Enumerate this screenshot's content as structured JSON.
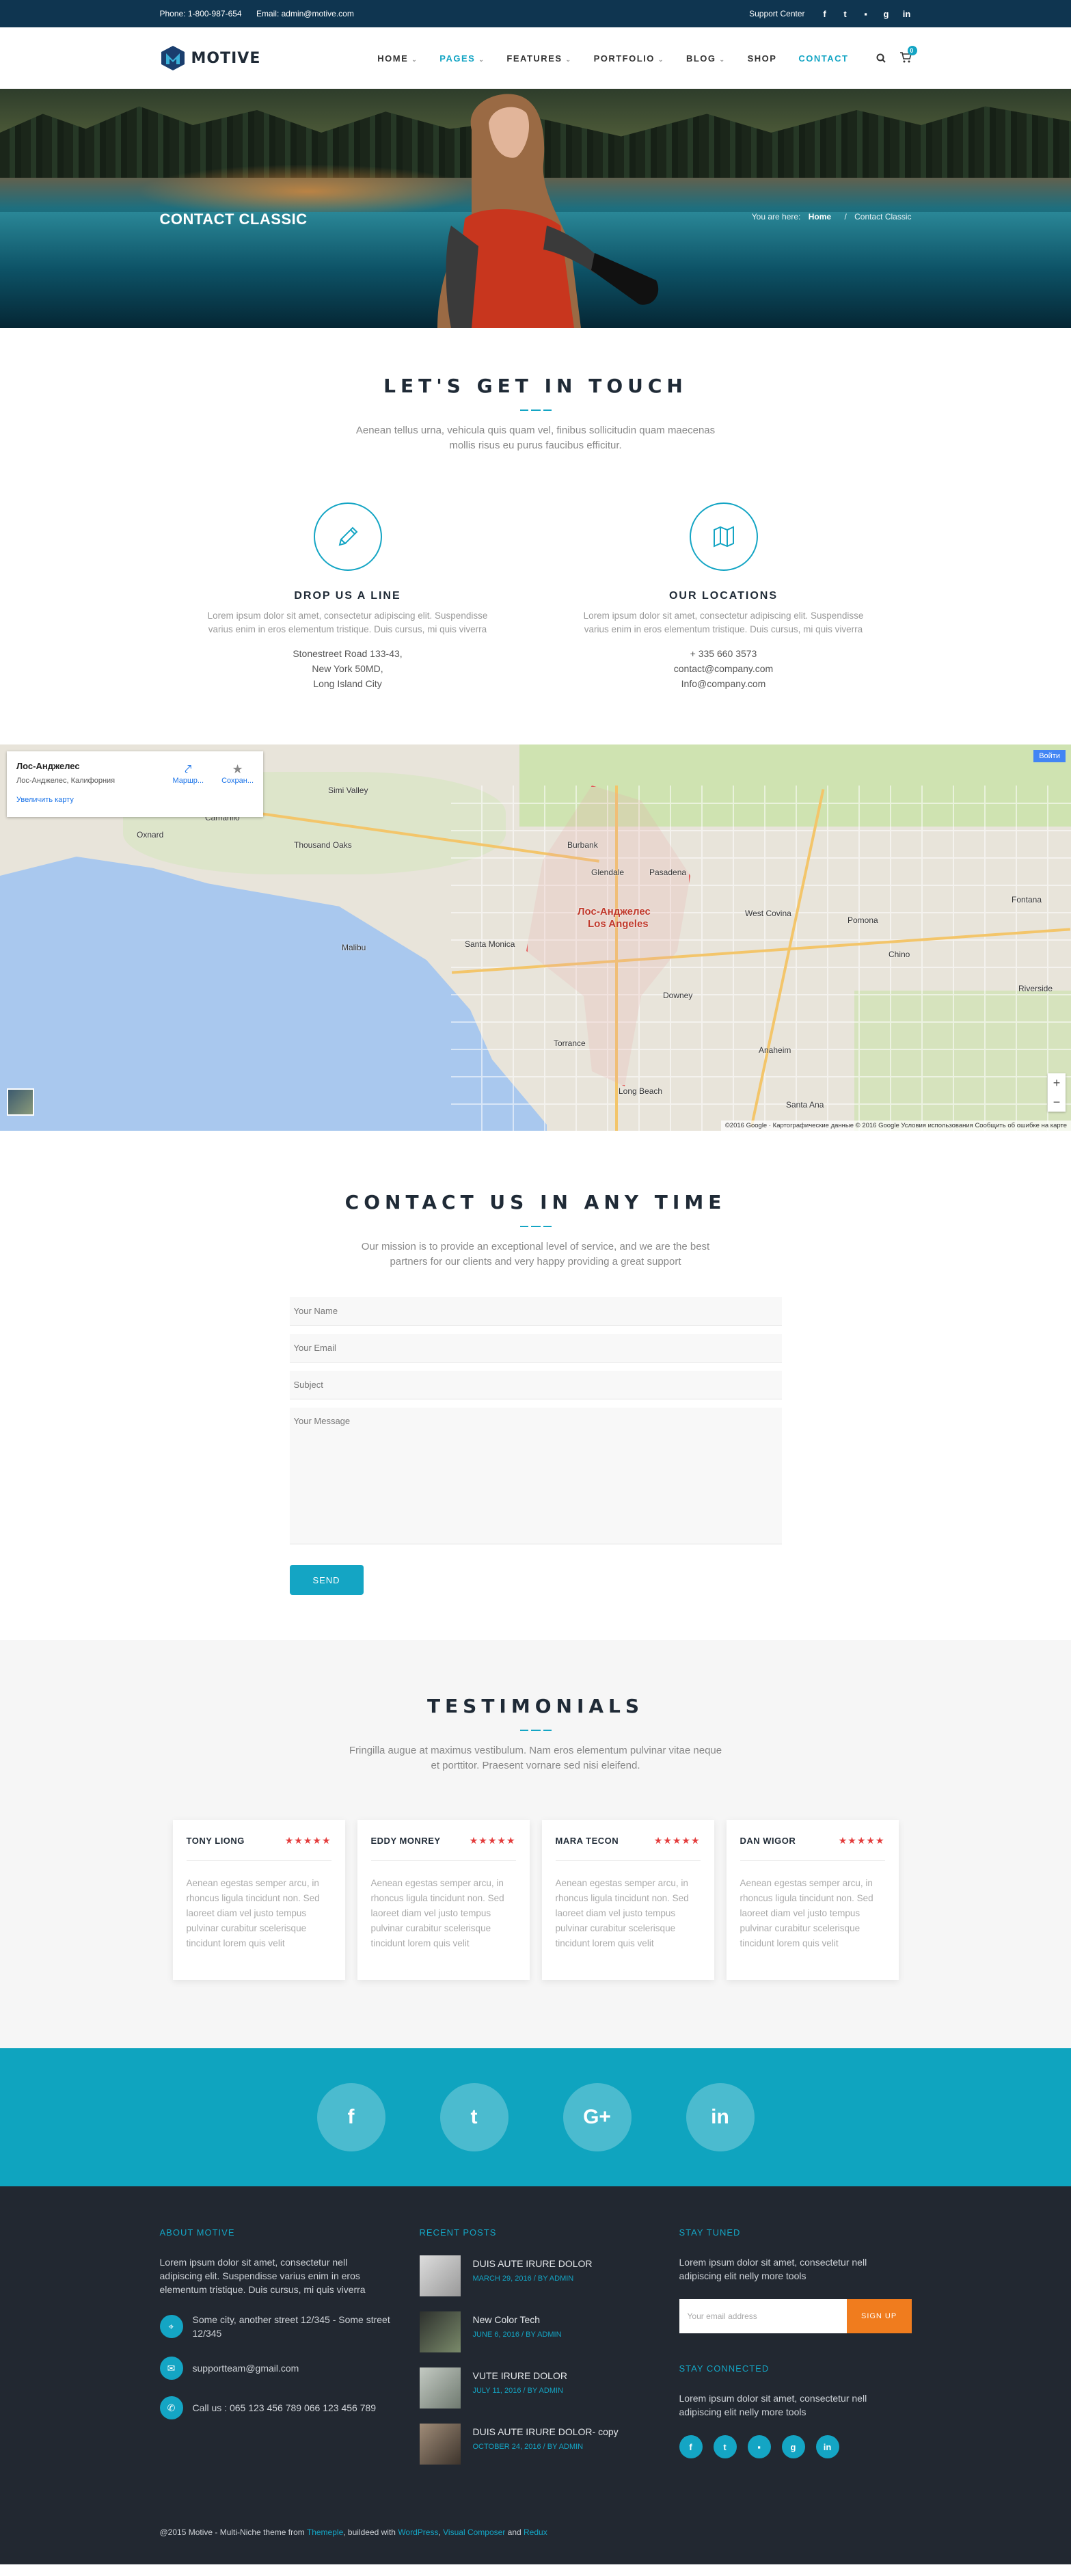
{
  "topbar": {
    "phone": "Phone: 1-800-987-654",
    "email": "Email: admin@motive.com",
    "support": "Support Center",
    "social": [
      {
        "icon": "facebook-icon",
        "glyph": "f"
      },
      {
        "icon": "twitter-icon",
        "glyph": "t"
      },
      {
        "icon": "flickr-icon",
        "glyph": "▪"
      },
      {
        "icon": "google-plus-icon",
        "glyph": "g"
      },
      {
        "icon": "linkedin-icon",
        "glyph": "in"
      }
    ]
  },
  "header": {
    "logo": "MOTIVE",
    "nav": [
      {
        "label": "HOME",
        "caret": true,
        "active": false
      },
      {
        "label": "PAGES",
        "caret": true,
        "active": true
      },
      {
        "label": "FEATURES",
        "caret": true,
        "active": false
      },
      {
        "label": "PORTFOLIO",
        "caret": true,
        "active": false
      },
      {
        "label": "BLOG",
        "caret": true,
        "active": false
      },
      {
        "label": "SHOP",
        "caret": false,
        "active": false
      },
      {
        "label": "CONTACT",
        "caret": false,
        "active": true
      }
    ],
    "cart_count": "0"
  },
  "hero": {
    "title": "CONTACT CLASSIC",
    "crumb_prefix": "You are here:",
    "crumb_home": "Home",
    "crumb_sep": "/",
    "crumb_current": "Contact Classic"
  },
  "touch": {
    "title": "LET'S GET IN TOUCH",
    "subtitle": "Aenean tellus urna, vehicula quis quam vel, finibus sollicitudin quam maecenas mollis risus eu purus faucibus efficitur.",
    "cols": [
      {
        "icon": "pencil-icon",
        "title": "DROP US A LINE",
        "text": "Lorem ipsum dolor sit amet, consectetur adipiscing elit. Suspendisse varius enim in eros elementum tristique. Duis cursus, mi quis viverra",
        "lines": [
          "Stonestreet Road 133-43,",
          "New York 50MD,",
          "Long Island City"
        ]
      },
      {
        "icon": "map-icon",
        "title": "OUR LOCATIONS",
        "text": "Lorem ipsum dolor sit amet, consectetur adipiscing elit. Suspendisse varius enim in eros elementum tristique. Duis cursus, mi quis viverra",
        "lines": [
          "+ 335 660 3573",
          "contact@company.com",
          "Info@company.com"
        ]
      }
    ]
  },
  "map": {
    "place": "Лос-Анджелес",
    "place_sub": "Лос-Анджелес, Калифорния",
    "enlarge": "Увеличить карту",
    "route": "Маршр...",
    "save": "Сохран...",
    "login": "Войти",
    "footer": "©2016 Google · Картографические данные © 2016 Google   Условия использования   Сообщить об ошибке на карте",
    "labels": [
      "Simi Valley",
      "Thousand Oaks",
      "Oxnard",
      "Camarillo",
      "Burbank",
      "Glendale",
      "Pasadena",
      "Santa Monica",
      "Los Angeles",
      "West Covina",
      "Pomona",
      "Torrance",
      "Long Beach",
      "Anaheim",
      "Santa Ana",
      "Riverside",
      "Fontana",
      "Malibu",
      "Downey",
      "Chino"
    ],
    "city_big": "Лос-Анджелес",
    "city_big_en": "Los Angeles"
  },
  "contact": {
    "title": "CONTACT US IN ANY TIME",
    "subtitle": "Our mission is to provide an exceptional level of service, and we are the best partners for our clients and very happy providing a great support",
    "name_ph": "Your Name",
    "email_ph": "Your Email",
    "subject_ph": "Subject",
    "message_ph": "Your Message",
    "send": "SEND"
  },
  "testimonials": {
    "title": "TESTIMONIALS",
    "subtitle": "Fringilla augue at maximus vestibulum. Nam eros elementum pulvinar vitae neque et porttitor. Praesent vornare sed nisi eleifend.",
    "stars": "★★★★★",
    "rating": 5,
    "items": [
      {
        "name": "TONY LIONG",
        "text": "Aenean egestas semper arcu, in rhoncus ligula tincidunt non. Sed laoreet diam vel justo tempus pulvinar curabitur scelerisque tincidunt lorem quis velit"
      },
      {
        "name": "EDDY MONREY",
        "text": "Aenean egestas semper arcu, in rhoncus ligula tincidunt non. Sed laoreet diam vel justo tempus pulvinar curabitur scelerisque tincidunt lorem quis velit"
      },
      {
        "name": "MARA TECON",
        "text": "Aenean egestas semper arcu, in rhoncus ligula tincidunt non. Sed laoreet diam vel justo tempus pulvinar curabitur scelerisque tincidunt lorem quis velit"
      },
      {
        "name": "DAN WIGOR",
        "text": "Aenean egestas semper arcu, in rhoncus ligula tincidunt non. Sed laoreet diam vel justo tempus pulvinar curabitur scelerisque tincidunt lorem quis velit"
      }
    ]
  },
  "social_band": [
    {
      "icon": "facebook-icon",
      "glyph": "f"
    },
    {
      "icon": "twitter-icon",
      "glyph": "t"
    },
    {
      "icon": "google-plus-icon",
      "glyph": "G+"
    },
    {
      "icon": "linkedin-icon",
      "glyph": "in"
    }
  ],
  "footer": {
    "about_title": "ABOUT MOTIVE",
    "about_text": "Lorem ipsum dolor sit amet, consectetur nell adipiscing elit. Suspendisse varius enim in eros elementum tristique. Duis cursus, mi quis viverra",
    "contacts": [
      {
        "icon": "location-icon",
        "glyph": "⌖",
        "text": "Some city, another street 12/345 - Some street 12/345"
      },
      {
        "icon": "email-icon",
        "glyph": "✉",
        "text": "supportteam@gmail.com"
      },
      {
        "icon": "phone-icon",
        "glyph": "✆",
        "text": "Call us : 065 123 456 789 066 123 456 789"
      }
    ],
    "posts_title": "RECENT POSTS",
    "posts": [
      {
        "title": "DUIS AUTE IRURE DOLOR",
        "date": "MARCH 29, 2016 / BY ADMIN",
        "thumb": "#c9c6c0"
      },
      {
        "title": "New Color Tech",
        "date": "JUNE 6, 2016 / BY ADMIN",
        "thumb": "#3a3d3a"
      },
      {
        "title": "VUTE IRURE DOLOR",
        "date": "JULY 11, 2016 / BY ADMIN",
        "thumb": "#9aa39b"
      },
      {
        "title": "DUIS AUTE IRURE DOLOR- copy",
        "date": "OCTOBER 24, 2016 / BY ADMIN",
        "thumb": "#6b5a4a"
      }
    ],
    "tuned_title": "STAY TUNED",
    "tuned_text": "Lorem ipsum dolor sit amet, consectetur nell adipiscing elit nelly more tools",
    "email_ph": "Your email address",
    "signup": "SIGN UP",
    "connected_title": "STAY CONNECTED",
    "connected_text": "Lorem ipsum dolor sit amet, consectetur nell adipiscing elit nelly more tools",
    "social": [
      {
        "icon": "facebook-icon",
        "glyph": "f"
      },
      {
        "icon": "twitter-icon",
        "glyph": "t"
      },
      {
        "icon": "flickr-icon",
        "glyph": "▪"
      },
      {
        "icon": "google-plus-icon",
        "glyph": "g"
      },
      {
        "icon": "linkedin-icon",
        "glyph": "in"
      }
    ],
    "copy_prefix": "@2015 Motive - Multi-Niche theme from",
    "copy_l1": "Themeple",
    "copy_mid": ", buildeed with",
    "copy_l2": "WordPress",
    "copy_comma": ",",
    "copy_l3": "Visual Composer",
    "copy_and": "and",
    "copy_l4": "Redux"
  },
  "colors": {
    "accent": "#14a5c4",
    "topbar": "#0f3550",
    "footer": "#222831",
    "signup": "#f07c1e",
    "stars": "#e33b3b"
  }
}
